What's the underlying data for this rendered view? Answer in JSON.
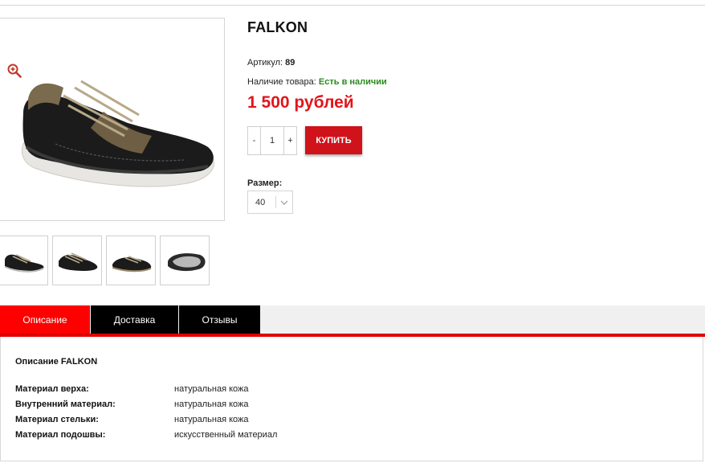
{
  "product": {
    "title": "FALKON",
    "sku_label": "Артикул: ",
    "sku_value": "89",
    "stock_label": "Наличие товара: ",
    "stock_value": "Есть в наличии",
    "price": "1 500 рублей",
    "quantity": "1",
    "qty_minus": "-",
    "qty_plus": "+",
    "buy_label": "КУПИТЬ",
    "size_label": "Размер:",
    "size_value": "40"
  },
  "tabs": [
    {
      "label": "Описание",
      "active": true
    },
    {
      "label": "Доставка",
      "active": false
    },
    {
      "label": "Отзывы",
      "active": false
    }
  ],
  "description": {
    "title": "Описание FALKON",
    "specs": [
      {
        "key": "Материал верха:",
        "value": "натуральная кожа"
      },
      {
        "key": "Внутренний материал:",
        "value": "натуральная кожа"
      },
      {
        "key": "Материал стельки:",
        "value": "натуральная кожа"
      },
      {
        "key": "Материал подошвы:",
        "value": "искусственный материал"
      }
    ]
  },
  "colors": {
    "price": "#e3141b",
    "buy_button": "#d0121b",
    "active_tab": "#ff0000",
    "tab": "#000000",
    "in_stock": "#2a8a1e"
  },
  "icons": {
    "zoom": "zoom-in-icon",
    "chevron": "chevron-down-icon"
  }
}
